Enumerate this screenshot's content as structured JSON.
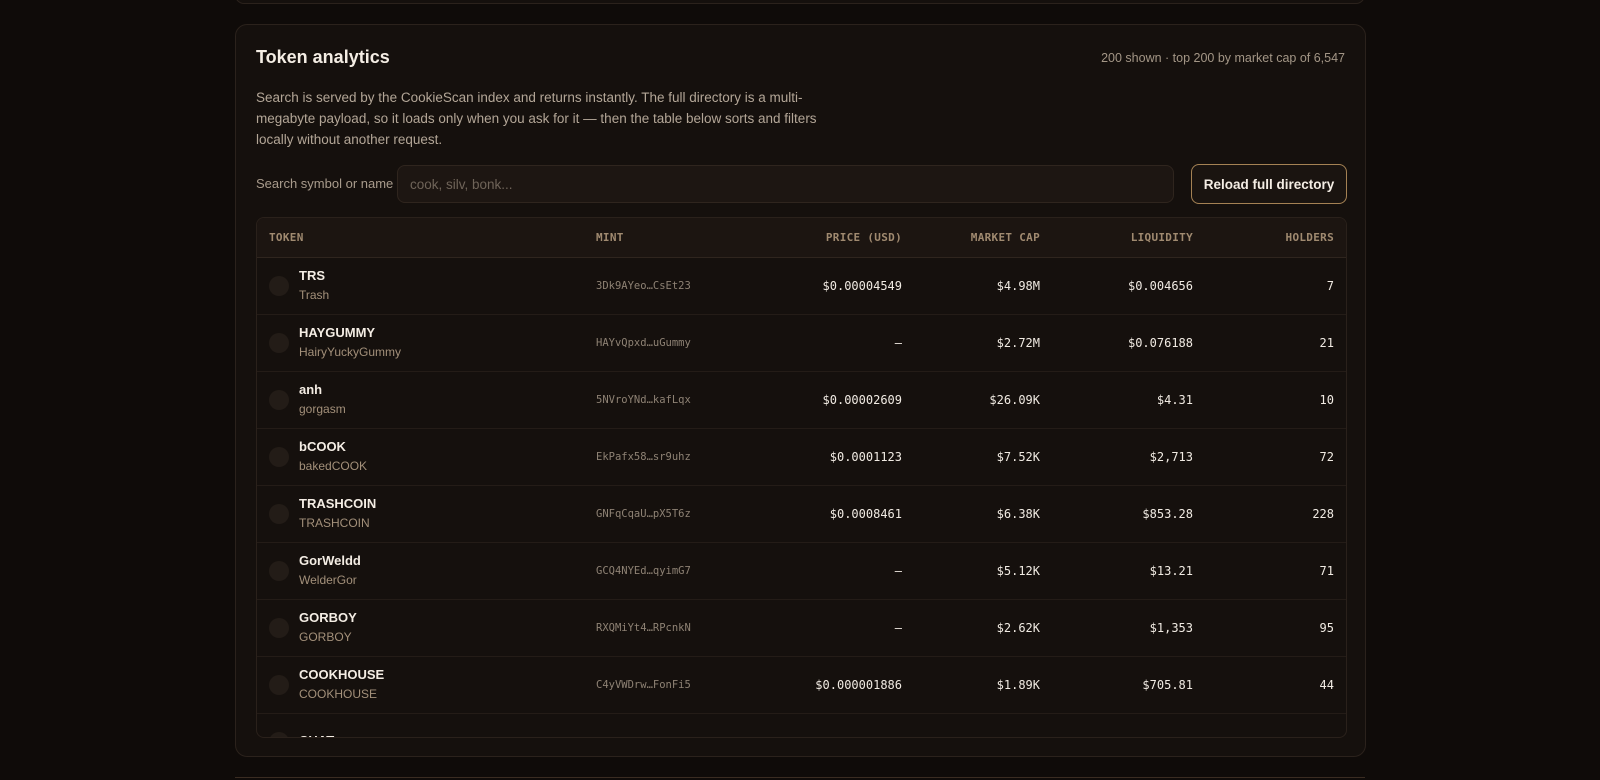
{
  "panel": {
    "title": "Token analytics",
    "meta": "200 shown · top 200 by market cap of 6,547",
    "description": "Search is served by the CookieScan index and returns instantly. The full directory is a multi-megabyte payload, so it loads only when you ask for it — then the table below sorts and filters locally without another request."
  },
  "search": {
    "label": "Search symbol or name",
    "placeholder": "cook, silv, bonk...",
    "value": ""
  },
  "reload_button": "Reload full directory",
  "table": {
    "headers": {
      "token": "TOKEN",
      "mint": "MINT",
      "price": "PRICE (USD)",
      "market_cap": "MARKET CAP",
      "liquidity": "LIQUIDITY",
      "holders": "HOLDERS"
    },
    "rows": [
      {
        "symbol": "TRS",
        "name": "Trash",
        "mint": "3Dk9AYeo…CsEt23",
        "price": "$0.00004549",
        "market_cap": "$4.98M",
        "liquidity": "$0.004656",
        "holders": "7"
      },
      {
        "symbol": "HAYGUMMY",
        "name": "HairyYuckyGummy",
        "mint": "HAYvQpxd…uGummy",
        "price": "—",
        "market_cap": "$2.72M",
        "liquidity": "$0.076188",
        "holders": "21"
      },
      {
        "symbol": "anh",
        "name": "gorgasm",
        "mint": "5NVroYNd…kafLqx",
        "price": "$0.00002609",
        "market_cap": "$26.09K",
        "liquidity": "$4.31",
        "holders": "10"
      },
      {
        "symbol": "bCOOK",
        "name": "bakedCOOK",
        "mint": "EkPafx58…sr9uhz",
        "price": "$0.0001123",
        "market_cap": "$7.52K",
        "liquidity": "$2,713",
        "holders": "72"
      },
      {
        "symbol": "TRASHCOIN",
        "name": "TRASHCOIN",
        "mint": "GNFqCqaU…pX5T6z",
        "price": "$0.0008461",
        "market_cap": "$6.38K",
        "liquidity": "$853.28",
        "holders": "228"
      },
      {
        "symbol": "GorWeldd",
        "name": "WelderGor",
        "mint": "GCQ4NYEd…qyimG7",
        "price": "—",
        "market_cap": "$5.12K",
        "liquidity": "$13.21",
        "holders": "71"
      },
      {
        "symbol": "GORBOY",
        "name": "GORBOY",
        "mint": "RXQMiYt4…RPcnkN",
        "price": "—",
        "market_cap": "$2.62K",
        "liquidity": "$1,353",
        "holders": "95"
      },
      {
        "symbol": "COOKHOUSE",
        "name": "COOKHOUSE",
        "mint": "C4yVWDrw…FonFi5",
        "price": "$0.000001886",
        "market_cap": "$1.89K",
        "liquidity": "$705.81",
        "holders": "44"
      },
      {
        "symbol": "CHAT",
        "name": "",
        "mint": "",
        "price": "",
        "market_cap": "",
        "liquidity": "",
        "holders": ""
      }
    ]
  }
}
